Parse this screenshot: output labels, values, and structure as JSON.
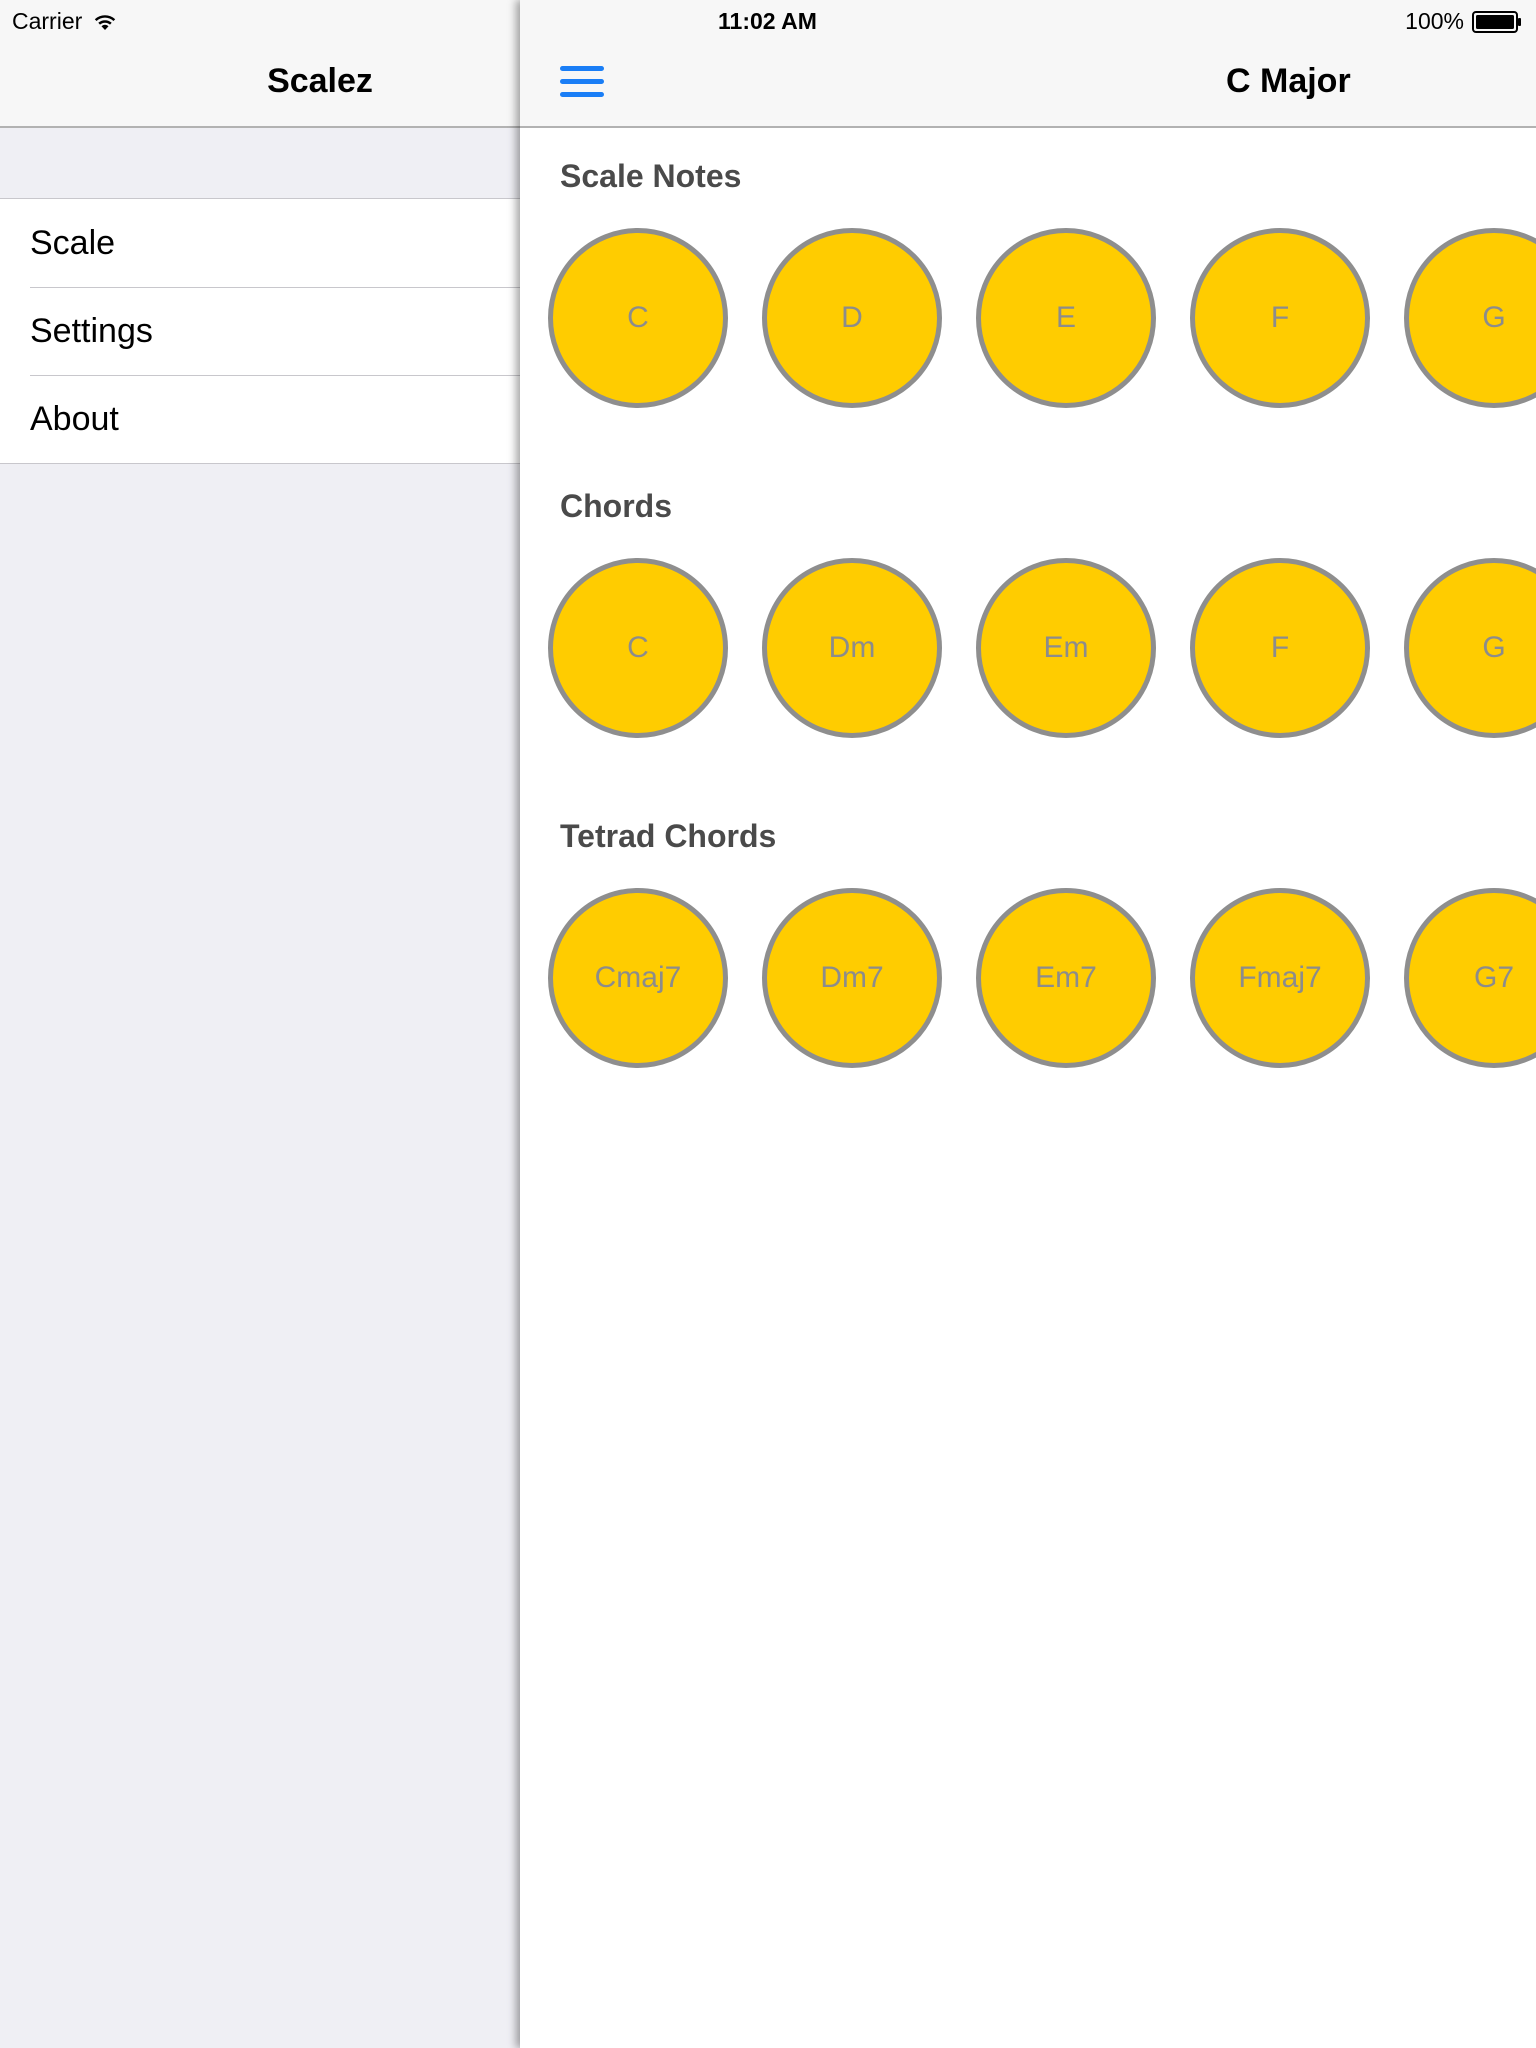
{
  "status_bar": {
    "carrier": "Carrier",
    "time": "11:02 AM",
    "battery": "100%"
  },
  "menu": {
    "title": "Scalez",
    "items": [
      {
        "label": "Scale"
      },
      {
        "label": "Settings"
      },
      {
        "label": "About"
      }
    ]
  },
  "main": {
    "title": "C Major",
    "sections": [
      {
        "heading": "Scale Notes",
        "items": [
          "C",
          "D",
          "E",
          "F",
          "G"
        ]
      },
      {
        "heading": "Chords",
        "items": [
          "C",
          "Dm",
          "Em",
          "F",
          "G"
        ]
      },
      {
        "heading": "Tetrad Chords",
        "items": [
          "Cmaj7",
          "Dm7",
          "Em7",
          "Fmaj7",
          "G7"
        ]
      }
    ]
  },
  "colors": {
    "accent": "#1a7ef6",
    "circle_fill": "#ffcc00",
    "circle_border": "#8e8e8e",
    "circle_text": "#8c8c8c"
  },
  "icons": {
    "menu": "hamburger-menu-icon",
    "wifi": "wifi-icon",
    "battery": "battery-icon"
  }
}
